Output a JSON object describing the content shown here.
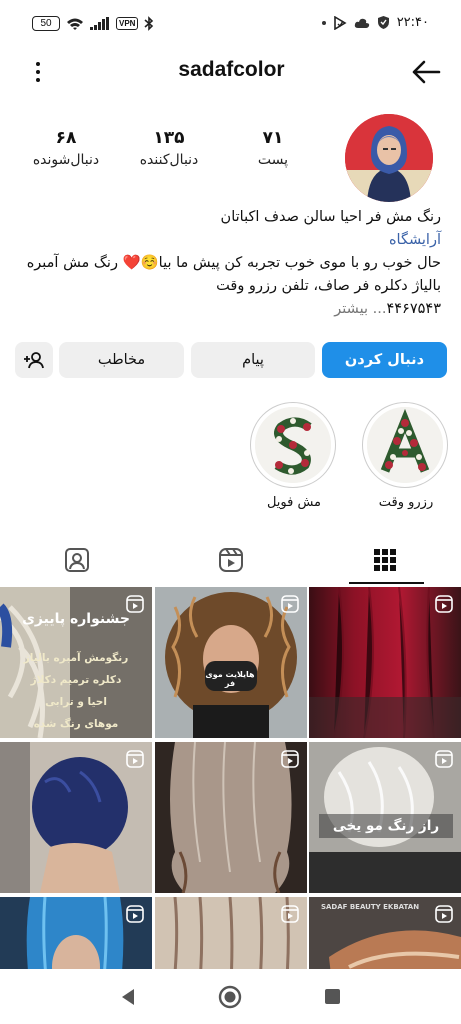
{
  "status_bar": {
    "battery": "50",
    "vpn": "VPN",
    "time": "۲۲:۴۰"
  },
  "header": {
    "username": "sadafcolor",
    "icons": [
      "more-vertical-icon",
      "back-arrow-icon"
    ]
  },
  "stats": {
    "posts": {
      "value": "۷۱",
      "label": "پست"
    },
    "followers": {
      "value": "۶۸",
      "label": "دنبال‌شونده"
    },
    "following": {
      "value": "۱۳۵",
      "label": "دنبال‌کننده"
    }
  },
  "bio": {
    "name": "رنگ مش فر احیا سالن صدف اکباتان",
    "category": "آرایشگاه",
    "line1": "حال خوب رو با موی خوب تجربه کن پیش ما بیا☺️❤️ رنگ مش آمبره",
    "line2": "بالیاژ دکلره فر صاف، تلفن رزرو وقت",
    "line3_number": "۴۴۶۷۵۴۳",
    "line3_more": "... بیشتر"
  },
  "buttons": {
    "follow": "دنبال کردن",
    "message": "پیام",
    "contact": "مخاطب"
  },
  "highlights": [
    {
      "label": "رزرو وقت",
      "letter": "A"
    },
    {
      "label": "مش فویل",
      "letter": "S"
    }
  ],
  "tabs": [
    "grid-tab",
    "reels-tab",
    "tagged-tab"
  ],
  "grid": {
    "post1_title": "جشنواره پاییزی",
    "post1_lines": [
      "رنگومش آمبره بالیاژ",
      "دکلره ترمیم دکلاژ",
      "احیا و ترابی",
      "موهای رنگ شده"
    ],
    "post2_caption": "هایلایت موی فر",
    "post6_caption": "راز رنگ مو یخی",
    "post9_watermark": "SADAF BEAUTY EKBATAN"
  },
  "colors": {
    "accent": "#1f8fe8",
    "link": "#3a62a8",
    "button_bg": "#efefef"
  }
}
